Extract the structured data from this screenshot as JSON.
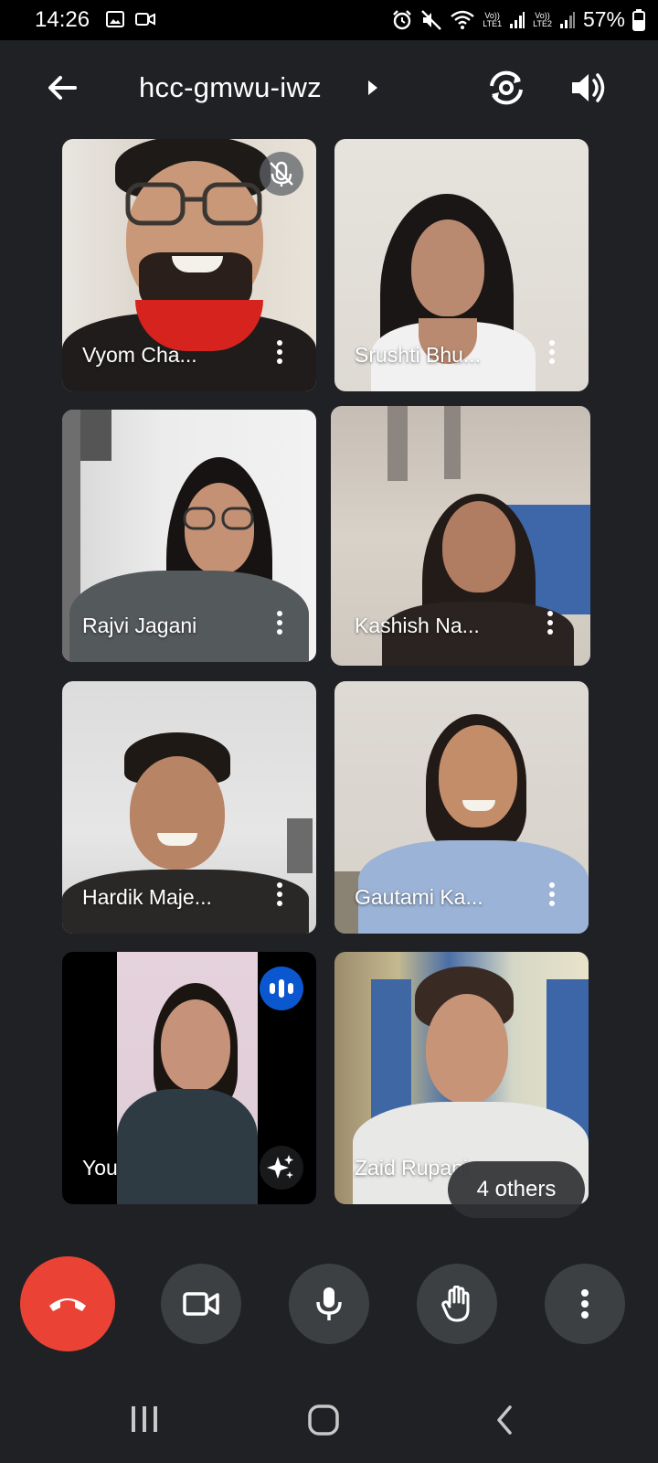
{
  "status_bar": {
    "time": "14:26",
    "battery": "57%",
    "sim1": "Vo))\nLTE1",
    "sim2": "Vo))\nLTE2"
  },
  "meeting": {
    "code": "hcc-gmwu-iwz"
  },
  "participants": [
    {
      "name": "Vyom  Cha...",
      "muted": true
    },
    {
      "name": "Srushti Bhu..."
    },
    {
      "name": "Rajvi  Jagani"
    },
    {
      "name": "Kashish Na...",
      "active_speaker": true
    },
    {
      "name": "Hardik Maje..."
    },
    {
      "name": "Gautami Ka..."
    },
    {
      "name": "You",
      "speaking": true
    },
    {
      "name": "Zaid Rupani"
    }
  ],
  "others_label": "4 others",
  "colors": {
    "background": "#202124",
    "end_call": "#ea4335",
    "accent_blue": "#0b57d0",
    "control_bg": "#3c4043"
  },
  "icons": {
    "back": "arrow-left-icon",
    "switch_camera": "switch-camera-icon",
    "speaker": "speaker-icon",
    "end_call": "phone-hangup-icon",
    "camera": "video-camera-icon",
    "mic": "microphone-icon",
    "hand": "raise-hand-icon",
    "more": "more-vertical-icon"
  }
}
